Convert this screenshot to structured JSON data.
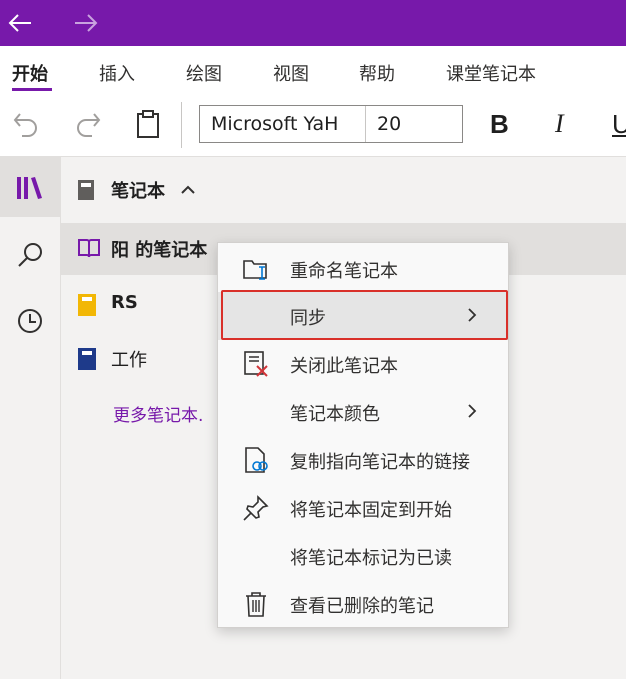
{
  "colors": {
    "brand": "#7719aa",
    "highlight_border": "#d9302a",
    "close_x": "#d13438",
    "rs_notebook": "#f2b705",
    "work_notebook": "#1e3a8a"
  },
  "titlebar": {
    "back_icon": "arrow-left-icon",
    "forward_icon": "arrow-right-icon"
  },
  "menu": {
    "tabs": [
      "开始",
      "插入",
      "绘图",
      "视图",
      "帮助",
      "课堂笔记本"
    ]
  },
  "toolbar": {
    "font_name": "Microsoft YaH",
    "font_size": "20",
    "bold_label": "B",
    "italic_label": "I",
    "underline_label": "U"
  },
  "notebooks": {
    "header": "笔记本",
    "items": [
      {
        "label": "阳 的笔记本",
        "icon": "book-open-icon"
      },
      {
        "label": "RS",
        "icon": "notebook-yellow-icon"
      },
      {
        "label": "工作",
        "icon": "notebook-blue-icon"
      }
    ],
    "more_link": "更多笔记本."
  },
  "context_menu": {
    "items": [
      {
        "label": "重命名笔记本",
        "icon": "rename-folder-icon"
      },
      {
        "label": "同步",
        "icon": "",
        "submenu": true
      },
      {
        "label": "关闭此笔记本",
        "icon": "close-notebook-icon"
      },
      {
        "label": "笔记本颜色",
        "icon": "",
        "submenu": true
      },
      {
        "label": "复制指向笔记本的链接",
        "icon": "copy-link-icon"
      },
      {
        "label": "将笔记本固定到开始",
        "icon": "pin-icon"
      },
      {
        "label": "将笔记本标记为已读",
        "icon": ""
      },
      {
        "label": "查看已删除的笔记",
        "icon": "trash-icon"
      }
    ]
  }
}
